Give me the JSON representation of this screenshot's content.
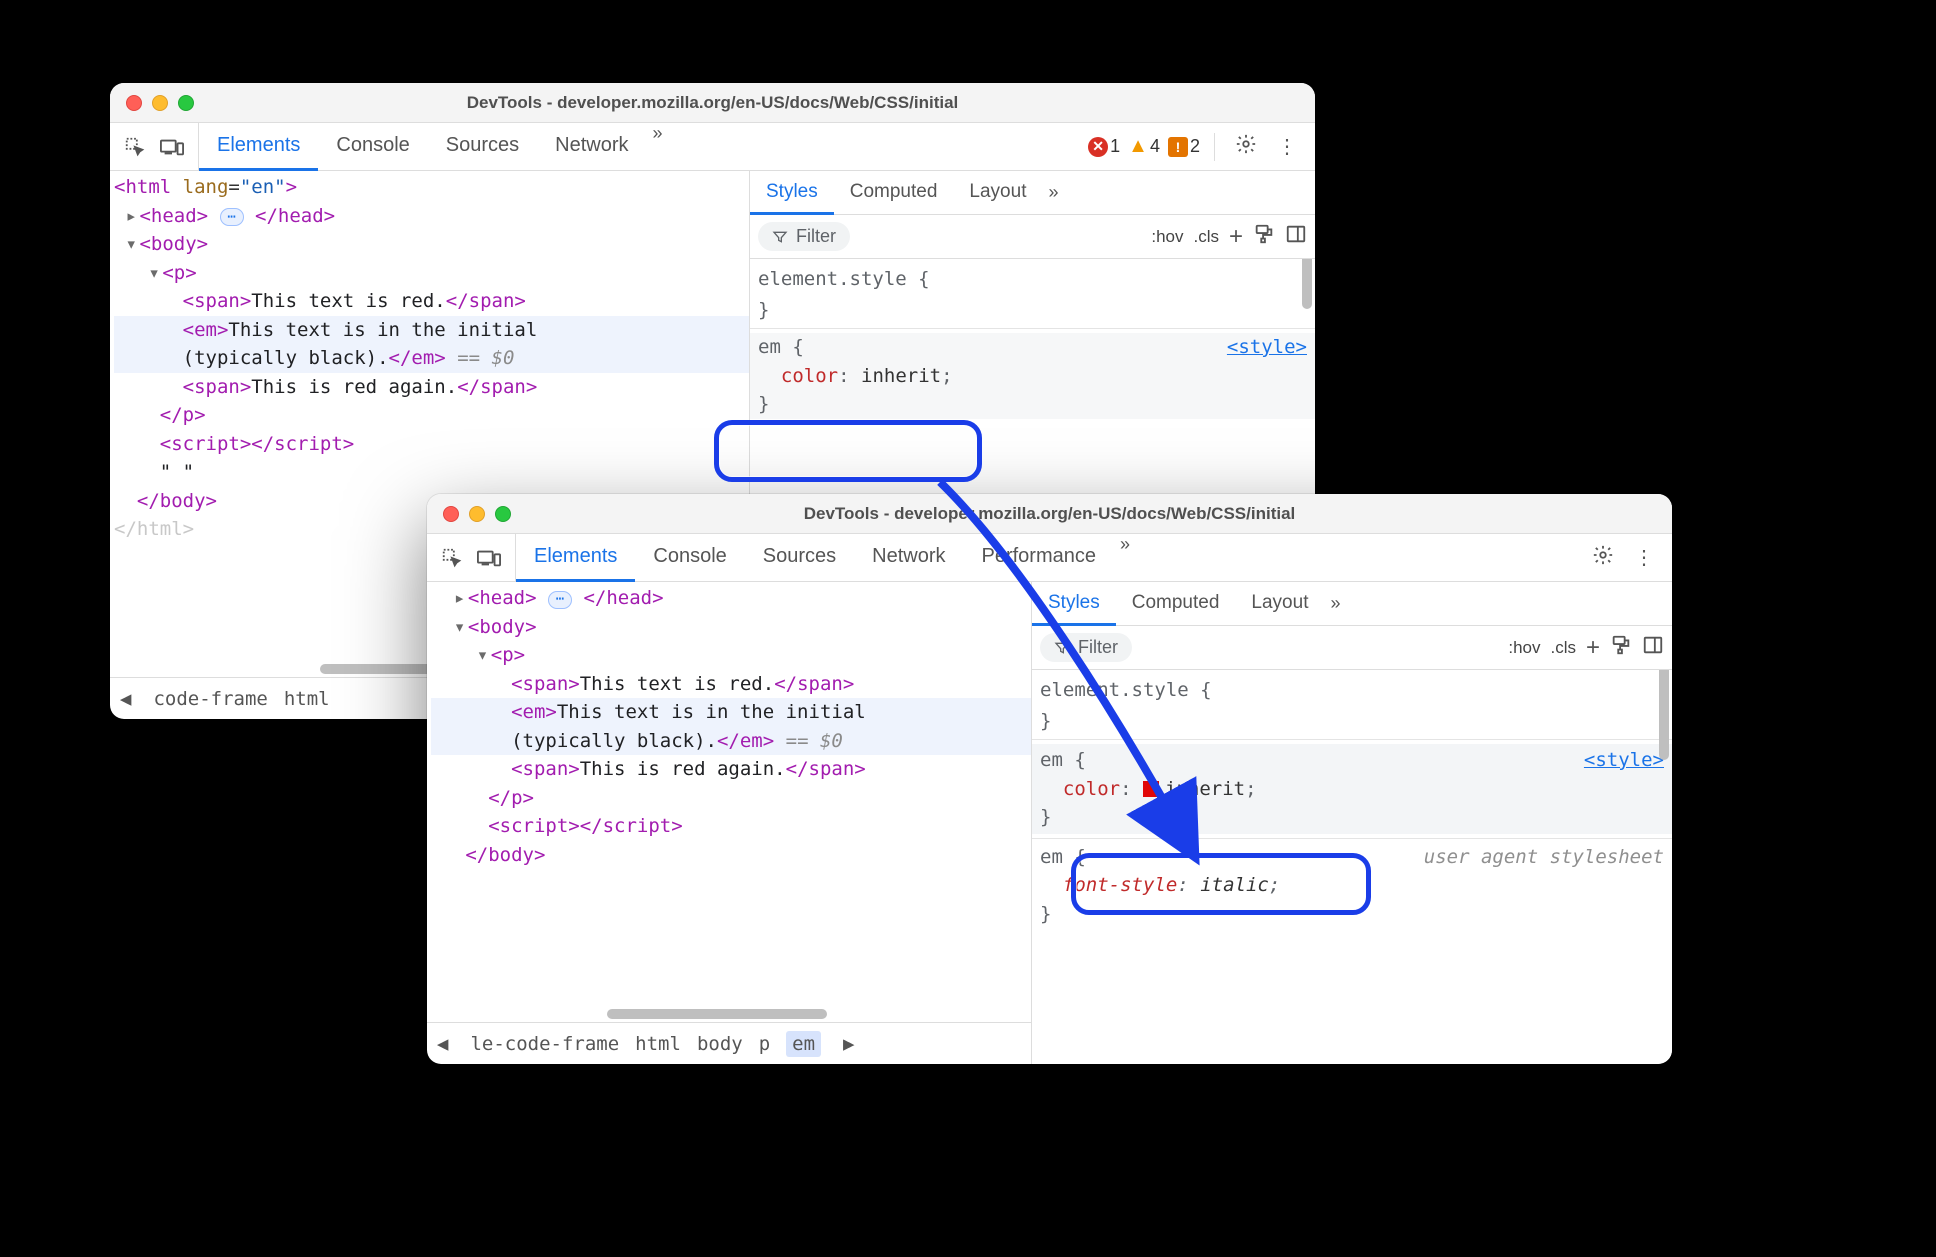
{
  "window_title": "DevTools - developer.mozilla.org/en-US/docs/Web/CSS/initial",
  "main_tabs": [
    "Elements",
    "Console",
    "Sources",
    "Network"
  ],
  "main_tabs_long": [
    "Elements",
    "Console",
    "Sources",
    "Network",
    "Performance"
  ],
  "badges": {
    "errors": "1",
    "warnings": "4",
    "issues": "2"
  },
  "dom": {
    "html_open": "<html lang=\"en\">",
    "head_open": "<head>",
    "head_close": "</head>",
    "body_open": "<body>",
    "body_close": "</body>",
    "p_open": "<p>",
    "p_close": "</p>",
    "span_open": "<span>",
    "span_close": "</span>",
    "em_open": "<em>",
    "em_close": "</em>",
    "script_open": "<script>",
    "script_close": "</script>",
    "text_red": "This text is red.",
    "text_initial_a": "This text is in the initial",
    "text_initial_a2": "This text is in the initial ",
    "text_initial_b": "(typically black).",
    "text_again": "This is red again.",
    "ws": "\" \"",
    "dollar0": "== $0",
    "html_close": "</html>"
  },
  "sty": {
    "tabs": [
      "Styles",
      "Computed",
      "Layout"
    ],
    "filter_placeholder": "Filter",
    "hov": ":hov",
    "cls": ".cls",
    "elementstyle": "element.style {",
    "close_brace": "}",
    "em_sel": "em {",
    "color_prop": "color",
    "inherit_val": "inherit",
    "style_src": "<style>",
    "ua_note": "user agent stylesheet",
    "fontstyle_prop": "font-style",
    "italic_val": "italic"
  },
  "crumbs_a": [
    "code-frame",
    "html"
  ],
  "crumbs_b": [
    "le-code-frame",
    "html",
    "body",
    "p",
    "em"
  ]
}
